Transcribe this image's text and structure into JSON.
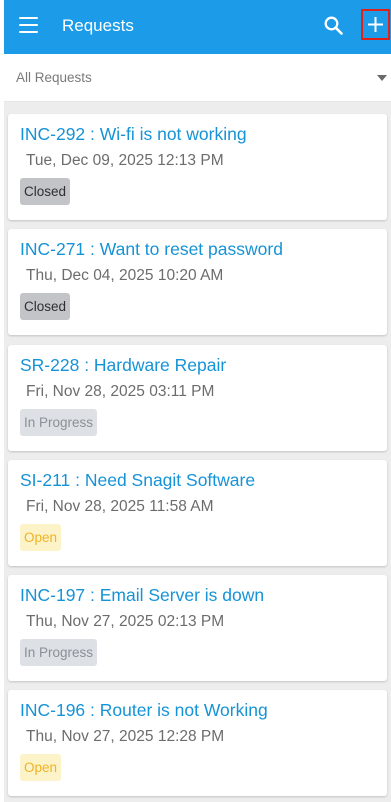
{
  "header": {
    "title": "Requests",
    "menu_icon": "menu-icon",
    "search_icon": "search-icon",
    "add_icon": "plus-icon"
  },
  "filter": {
    "selected": "All Requests"
  },
  "requests": [
    {
      "title": "INC-292 : Wi-fi is not working",
      "date": "Tue, Dec 09, 2025 12:13 PM",
      "status": "Closed"
    },
    {
      "title": "INC-271 : Want to reset password",
      "date": "Thu, Dec 04, 2025 10:20 AM",
      "status": "Closed"
    },
    {
      "title": "SR-228 : Hardware Repair",
      "date": "Fri, Nov 28, 2025 03:11 PM",
      "status": "In Progress"
    },
    {
      "title": "SI-211 : Need Snagit Software",
      "date": "Fri, Nov 28, 2025 11:58 AM",
      "status": "Open"
    },
    {
      "title": "INC-197 : Email Server is down",
      "date": "Thu, Nov 27, 2025 02:13 PM",
      "status": "In Progress"
    },
    {
      "title": "INC-196 : Router is not Working",
      "date": "Thu, Nov 27, 2025 12:28 PM",
      "status": "Open"
    }
  ],
  "colors": {
    "app_bar": "#1b9be8",
    "title_link": "#1693d6",
    "add_highlight": "#e0201b",
    "closed_badge": "#c2c4c7",
    "progress_badge": "#dde0e4",
    "open_badge": "#fdf3c9"
  }
}
